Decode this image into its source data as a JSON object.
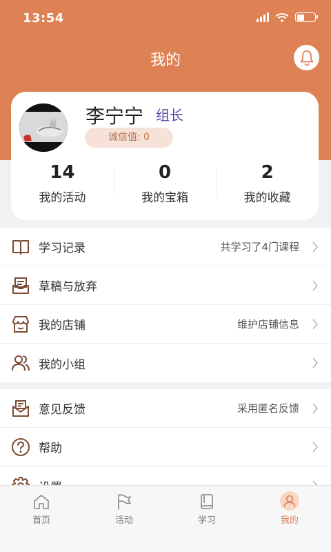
{
  "status_bar": {
    "time": "13:54",
    "battery_level": 0.4
  },
  "header": {
    "title": "我的"
  },
  "profile": {
    "name": "李宁宁",
    "role": "组长",
    "credit": "诚信值: 0"
  },
  "stats": [
    {
      "value": "14",
      "label": "我的活动"
    },
    {
      "value": "0",
      "label": "我的宝箱"
    },
    {
      "value": "2",
      "label": "我的收藏"
    }
  ],
  "menu": {
    "group1": [
      {
        "label": "学习记录",
        "hint": "共学习了4门课程",
        "icon": "book-icon"
      },
      {
        "label": "草稿与放弃",
        "hint": "",
        "icon": "inbox-icon"
      },
      {
        "label": "我的店铺",
        "hint": "维护店铺信息",
        "icon": "store-icon"
      },
      {
        "label": "我的小组",
        "hint": "",
        "icon": "group-icon"
      }
    ],
    "group2": [
      {
        "label": "意见反馈",
        "hint": "采用匿名反馈",
        "icon": "feedback-icon"
      },
      {
        "label": "帮助",
        "hint": "",
        "icon": "help-icon"
      },
      {
        "label": "设置",
        "hint": "",
        "icon": "settings-icon"
      }
    ]
  },
  "tabs": [
    {
      "label": "首页",
      "icon": "home-icon",
      "active": false
    },
    {
      "label": "活动",
      "icon": "flag-icon",
      "active": false
    },
    {
      "label": "学习",
      "icon": "book-icon",
      "active": false
    },
    {
      "label": "我的",
      "icon": "user-icon",
      "active": true
    }
  ],
  "colors": {
    "accent": "#de8256",
    "role": "#5545a8",
    "icon": "#7a4a32"
  }
}
